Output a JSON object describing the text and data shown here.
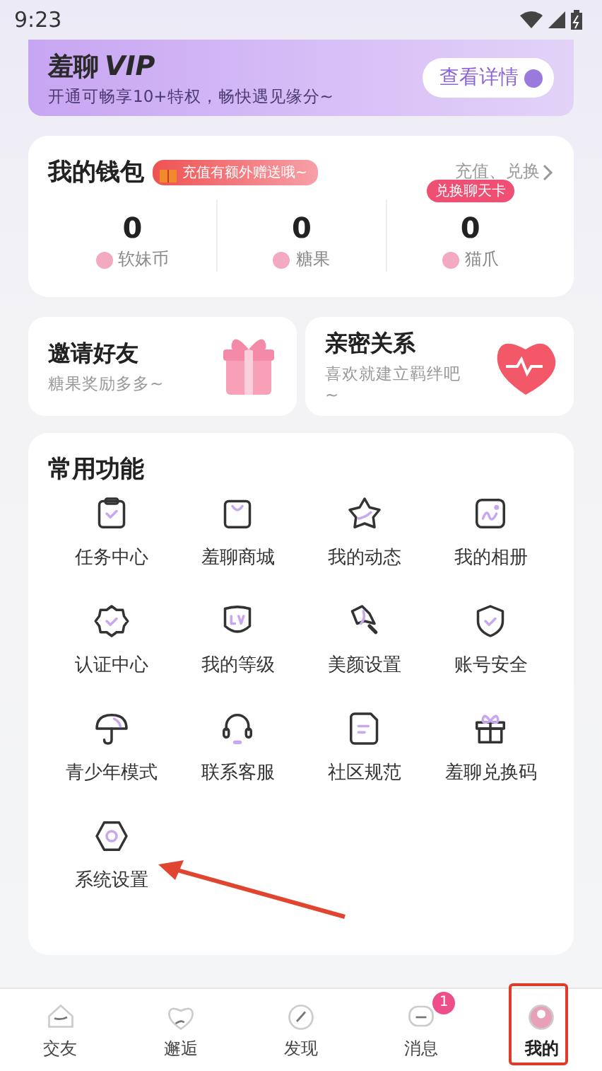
{
  "status_bar": {
    "time": "9:23"
  },
  "vip_banner": {
    "title": "羞聊",
    "badge": "VIP",
    "subtitle": "开通可畅享10+特权，畅快遇见缘分~",
    "button": "查看详情"
  },
  "wallet": {
    "title": "我的钱包",
    "promo": "充值有额外赠送哦~",
    "link": "充值、兑换",
    "balances": [
      {
        "value": "0",
        "label": "软妹币"
      },
      {
        "value": "0",
        "label": "糖果"
      },
      {
        "value": "0",
        "label": "猫爪",
        "tip": "兑换聊天卡"
      }
    ]
  },
  "promo_cards": [
    {
      "kind": "gift",
      "title": "邀请好友",
      "subtitle": "糖果奖励多多~"
    },
    {
      "kind": "heart",
      "title": "亲密关系",
      "subtitle": "喜欢就建立羁绊吧~"
    }
  ],
  "features": {
    "title": "常用功能",
    "items": [
      {
        "kind": "clipboard",
        "label": "任务中心"
      },
      {
        "kind": "bag",
        "label": "羞聊商城"
      },
      {
        "kind": "star",
        "label": "我的动态"
      },
      {
        "kind": "photo",
        "label": "我的相册"
      },
      {
        "kind": "badge",
        "label": "认证中心"
      },
      {
        "kind": "level",
        "label": "我的等级"
      },
      {
        "kind": "wand",
        "label": "美颜设置"
      },
      {
        "kind": "shield",
        "label": "账号安全"
      },
      {
        "kind": "umbrella",
        "label": "青少年模式"
      },
      {
        "kind": "headset",
        "label": "联系客服"
      },
      {
        "kind": "document",
        "label": "社区规范"
      },
      {
        "kind": "gift",
        "label": "羞聊兑换码"
      },
      {
        "kind": "settings",
        "label": "系统设置"
      }
    ]
  },
  "tab_bar": [
    {
      "label": "交友",
      "selected": false
    },
    {
      "label": "邂逅",
      "selected": false
    },
    {
      "label": "发现",
      "selected": false
    },
    {
      "label": "消息",
      "selected": false,
      "badge": "1"
    },
    {
      "label": "我的",
      "selected": true
    }
  ]
}
